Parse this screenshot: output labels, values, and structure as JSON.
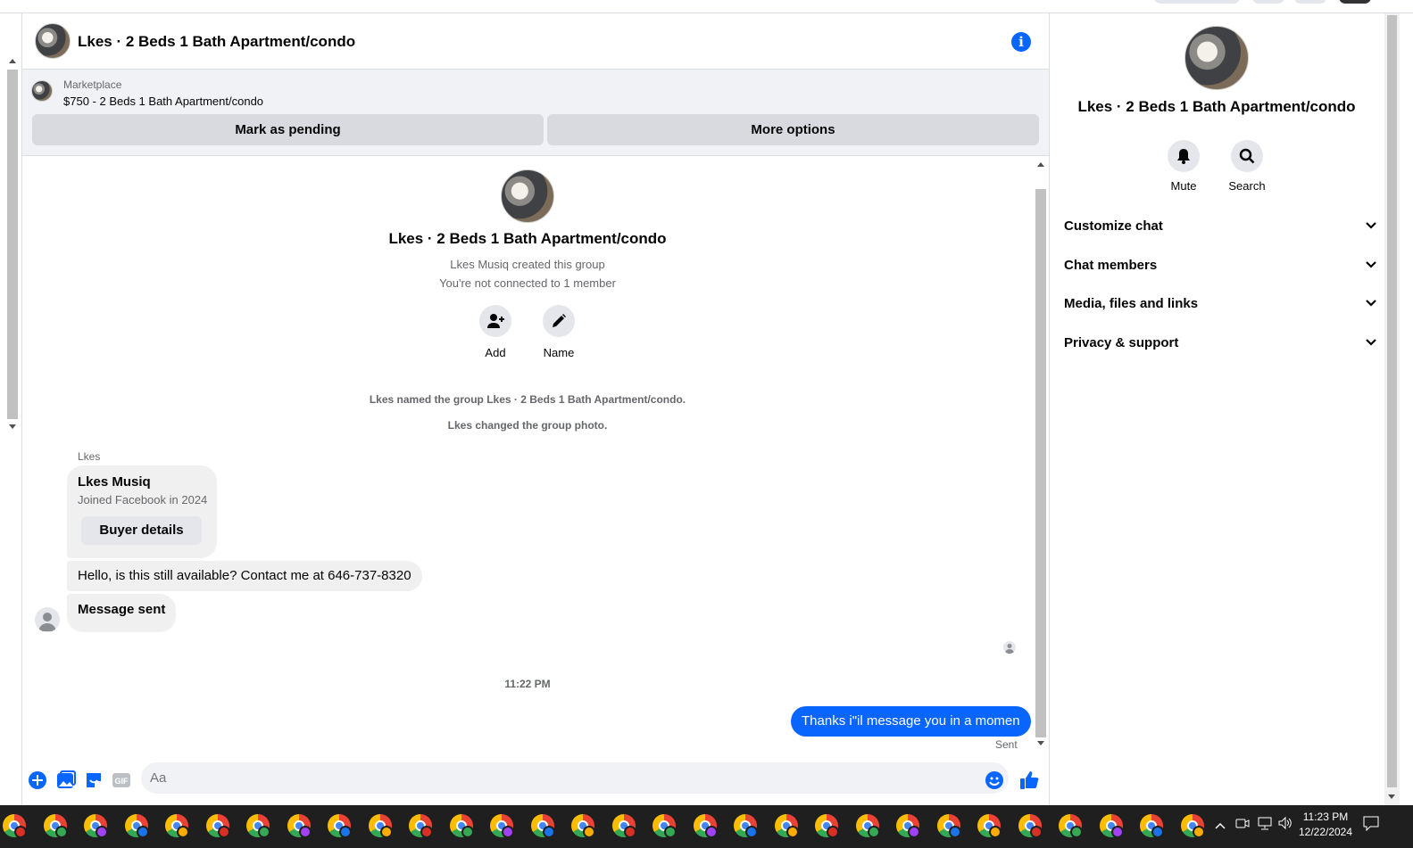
{
  "header": {
    "title": "Lkes · 2 Beds 1 Bath Apartment/condo",
    "info_icon": "info-icon",
    "info_glyph": "i"
  },
  "marketplace": {
    "label": "Marketplace",
    "listing": "$750 - 2 Beds 1 Bath Apartment/condo",
    "mark_pending": "Mark as pending",
    "more_options": "More options"
  },
  "group_intro": {
    "title": "Lkes · 2 Beds 1 Bath Apartment/condo",
    "created": "Lkes Musiq created this group",
    "not_connected": "You're not connected to 1 member",
    "add_label": "Add",
    "name_label": "Name"
  },
  "system_messages": {
    "named": "Lkes named the group Lkes · 2 Beds 1 Bath Apartment/condo.",
    "photo": "Lkes changed the group photo."
  },
  "messages": {
    "sender": "Lkes",
    "buyer_card": {
      "name": "Lkes Musiq",
      "joined": "Joined Facebook in 2024",
      "button": "Buyer details"
    },
    "hello": "Hello, is this still available? Contact me at 646-737-8320",
    "message_sent": "Message sent",
    "timestamp": "11:22 PM",
    "my_message": "Thanks i\"il message you in a momen",
    "status": "Sent"
  },
  "composer": {
    "placeholder": "Aa"
  },
  "right_panel": {
    "title": "Lkes · 2 Beds 1 Bath Apartment/condo",
    "mute": "Mute",
    "search": "Search",
    "sections": [
      "Customize chat",
      "Chat members",
      "Media, files and links",
      "Privacy & support"
    ]
  },
  "taskbar": {
    "time": "11:23 PM",
    "date": "12/22/2024",
    "app_count": 30
  },
  "colors": {
    "accent": "#0866ff",
    "bubble_grey": "#f0f0f0",
    "button_grey": "#d8dadf",
    "taskbar": "#1f1f1f"
  }
}
